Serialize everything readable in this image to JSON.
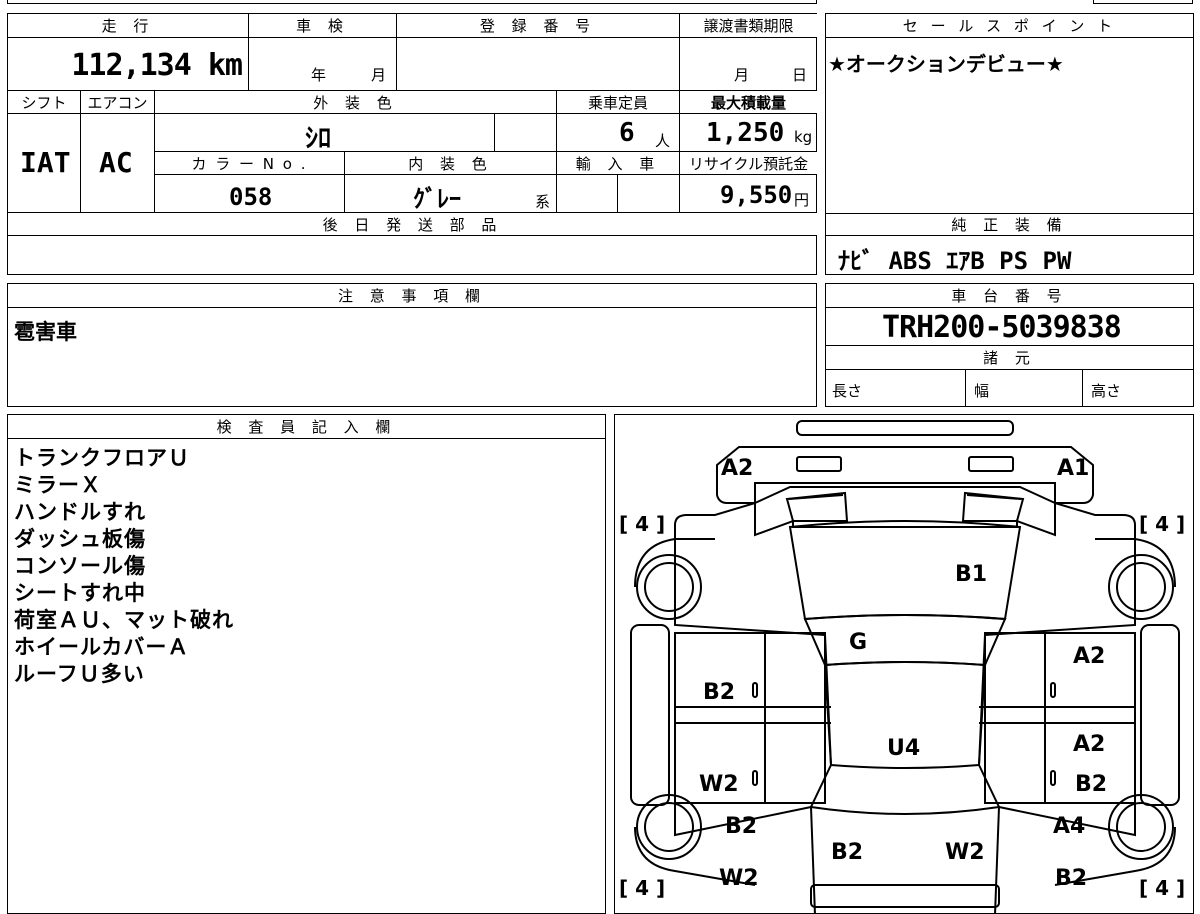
{
  "main": {
    "labels": {
      "mileage": "走 行",
      "inspection": "車 検",
      "registration": "登 録 番 号",
      "transfer_deadline": "譲渡書類期限",
      "shift": "シフト",
      "aircon": "エアコン",
      "exterior_color": "外 装 色",
      "capacity": "乗車定員",
      "max_load": "最大積載量",
      "color_no": "カ ラ ー N o .",
      "interior_color": "内 装 色",
      "imported": "輸 入 車",
      "recycle": "リサイクル預託金",
      "later_parts": "後 日 発 送 部 品"
    },
    "mileage": "112,134 km",
    "inspection_year": "年",
    "inspection_month": "月",
    "deadline_month": "月",
    "deadline_day": "日",
    "shift": "IAT",
    "aircon": "AC",
    "exterior_color": "ｼﾛ",
    "capacity_value": "6",
    "capacity_unit": "人",
    "max_load_value": "1,250",
    "max_load_unit": "kg",
    "color_no": "058",
    "interior_color": "ｸﾞﾚｰ",
    "interior_suffix": "系",
    "recycle_value": "9,550",
    "recycle_unit": "円"
  },
  "sales": {
    "header": "セ ー ル ス ポ イ ン ト",
    "text": "★オークションデビュー★"
  },
  "equipment": {
    "header": "純 正 装 備",
    "text": "ﾅﾋﾞ ABS ｴｱB PS PW"
  },
  "notes": {
    "header": "注 意 事 項 欄",
    "text": "雹害車"
  },
  "chassis": {
    "header": "車 台 番 号",
    "number": "TRH200-5039838",
    "specs_header": "諸 元",
    "length": "長さ",
    "width": "幅",
    "height": "高さ"
  },
  "inspector": {
    "header": "検 査 員 記 入 欄",
    "lines": [
      "トランクフロアＵ",
      "ミラーＸ",
      "ハンドルすれ",
      "ダッシュ板傷",
      "コンソール傷",
      "シートすれ中",
      "荷室ＡＵ、マット破れ",
      "ホイールカバーＡ",
      "ルーフＵ多い"
    ]
  },
  "diagram": {
    "marks": {
      "a2_top": "A2",
      "a1_top": "A1",
      "bracket_tl": "[ 4 ]",
      "bracket_tr": "[ 4 ]",
      "bracket_bl": "[ 4 ]",
      "bracket_br": "[ 4 ]",
      "b1": "B1",
      "g": "G",
      "a2_right": "A2",
      "b2_left": "B2",
      "zero_l1": "0",
      "zero_r1": "0",
      "u4": "U4",
      "a2_right2": "A2",
      "w2_left": "W2",
      "zero_l2": "0",
      "zero_r2": "0",
      "b2_right": "B2",
      "b2_left2": "B2",
      "a4_right": "A4",
      "b2_rear_l": "B2",
      "w2_rear_r": "W2",
      "w2_left2": "W2",
      "b2_right2": "B2"
    }
  }
}
